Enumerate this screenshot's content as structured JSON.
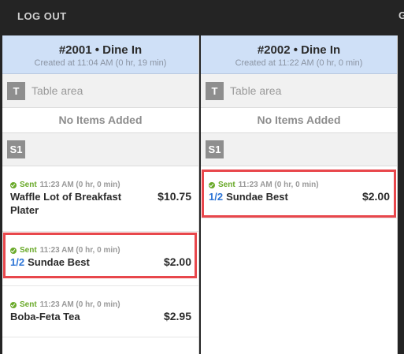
{
  "topbar": {
    "logout_label": "LOG OUT",
    "edge_glyph": "G"
  },
  "colors": {
    "header_blue": "#cfe0f7",
    "sent_green": "#6aaa2a",
    "portion_blue": "#2c74d6",
    "highlight_red": "#e8474c"
  },
  "orders": [
    {
      "title": "#2001 • Dine In",
      "created": "Created at 11:04 AM (0 hr, 19 min)",
      "table_badge": "T",
      "table_label": "Table area",
      "no_items": "No Items Added",
      "seat_badge": "S1",
      "items": [
        {
          "status": "Sent",
          "time": "11:23 AM (0 hr, 0 min)",
          "portion": "",
          "name": "Waffle Lot of Breakfast Plater",
          "price": "$10.75",
          "highlighted": false
        },
        {
          "status": "Sent",
          "time": "11:23 AM (0 hr, 0 min)",
          "portion": "1/2",
          "name": "Sundae Best",
          "price": "$2.00",
          "highlighted": true
        },
        {
          "status": "Sent",
          "time": "11:23 AM (0 hr, 0 min)",
          "portion": "",
          "name": "Boba-Feta Tea",
          "price": "$2.95",
          "highlighted": false
        }
      ]
    },
    {
      "title": "#2002 • Dine In",
      "created": "Created at 11:22 AM (0 hr, 0 min)",
      "table_badge": "T",
      "table_label": "Table area",
      "no_items": "No Items Added",
      "seat_badge": "S1",
      "items": [
        {
          "status": "Sent",
          "time": "11:23 AM (0 hr, 0 min)",
          "portion": "1/2",
          "name": "Sundae Best",
          "price": "$2.00",
          "highlighted": true
        }
      ]
    }
  ]
}
